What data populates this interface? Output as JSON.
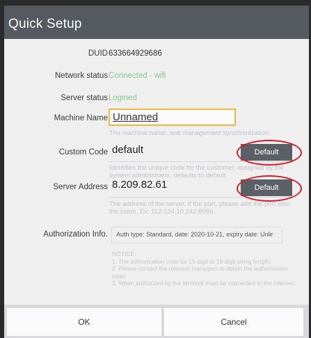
{
  "dialog": {
    "title": "Quick Setup"
  },
  "fields": {
    "duid": {
      "label": "DUID",
      "value": "633664929686"
    },
    "network_status": {
      "label": "Network status",
      "value": "Connected - wifi"
    },
    "server_status": {
      "label": "Server status",
      "value": "Logined"
    },
    "machine_name": {
      "label": "Machine Name",
      "value": "Unnamed",
      "hint": "The machine name, and management synchronization"
    },
    "custom_code": {
      "label": "Custom Code",
      "value": "default",
      "button": "Default",
      "hint": "Identifies the unique code for the customer, assigned by the system administrator, defaults to default"
    },
    "server_address": {
      "label": "Server Address",
      "value": "8.209.82.61",
      "button": "Default",
      "hint": "The address of the server, if the port, please add the port after the colon, Ex: 112.124.10.242:8086"
    },
    "authorization": {
      "label": "Authorization Info.",
      "value": "Auth type: Standard, date: 2020-10-21, expiry date: Unlir"
    }
  },
  "notice": {
    "title": "NOTICE:",
    "line1": "1. The authorization code for 15 digit or 16 digit string length;",
    "line2": "2. Please contact the relevant managers to obtain the authorization code;",
    "line3": "3. When authorized by the terminal must be connected to the Internet;"
  },
  "footer": {
    "ok": "OK",
    "cancel": "Cancel"
  },
  "colors": {
    "titlebar": "#555a60",
    "status_green": "#86c98a",
    "focus_border": "#f2b83a",
    "highlight_ring": "#d21b2a"
  }
}
